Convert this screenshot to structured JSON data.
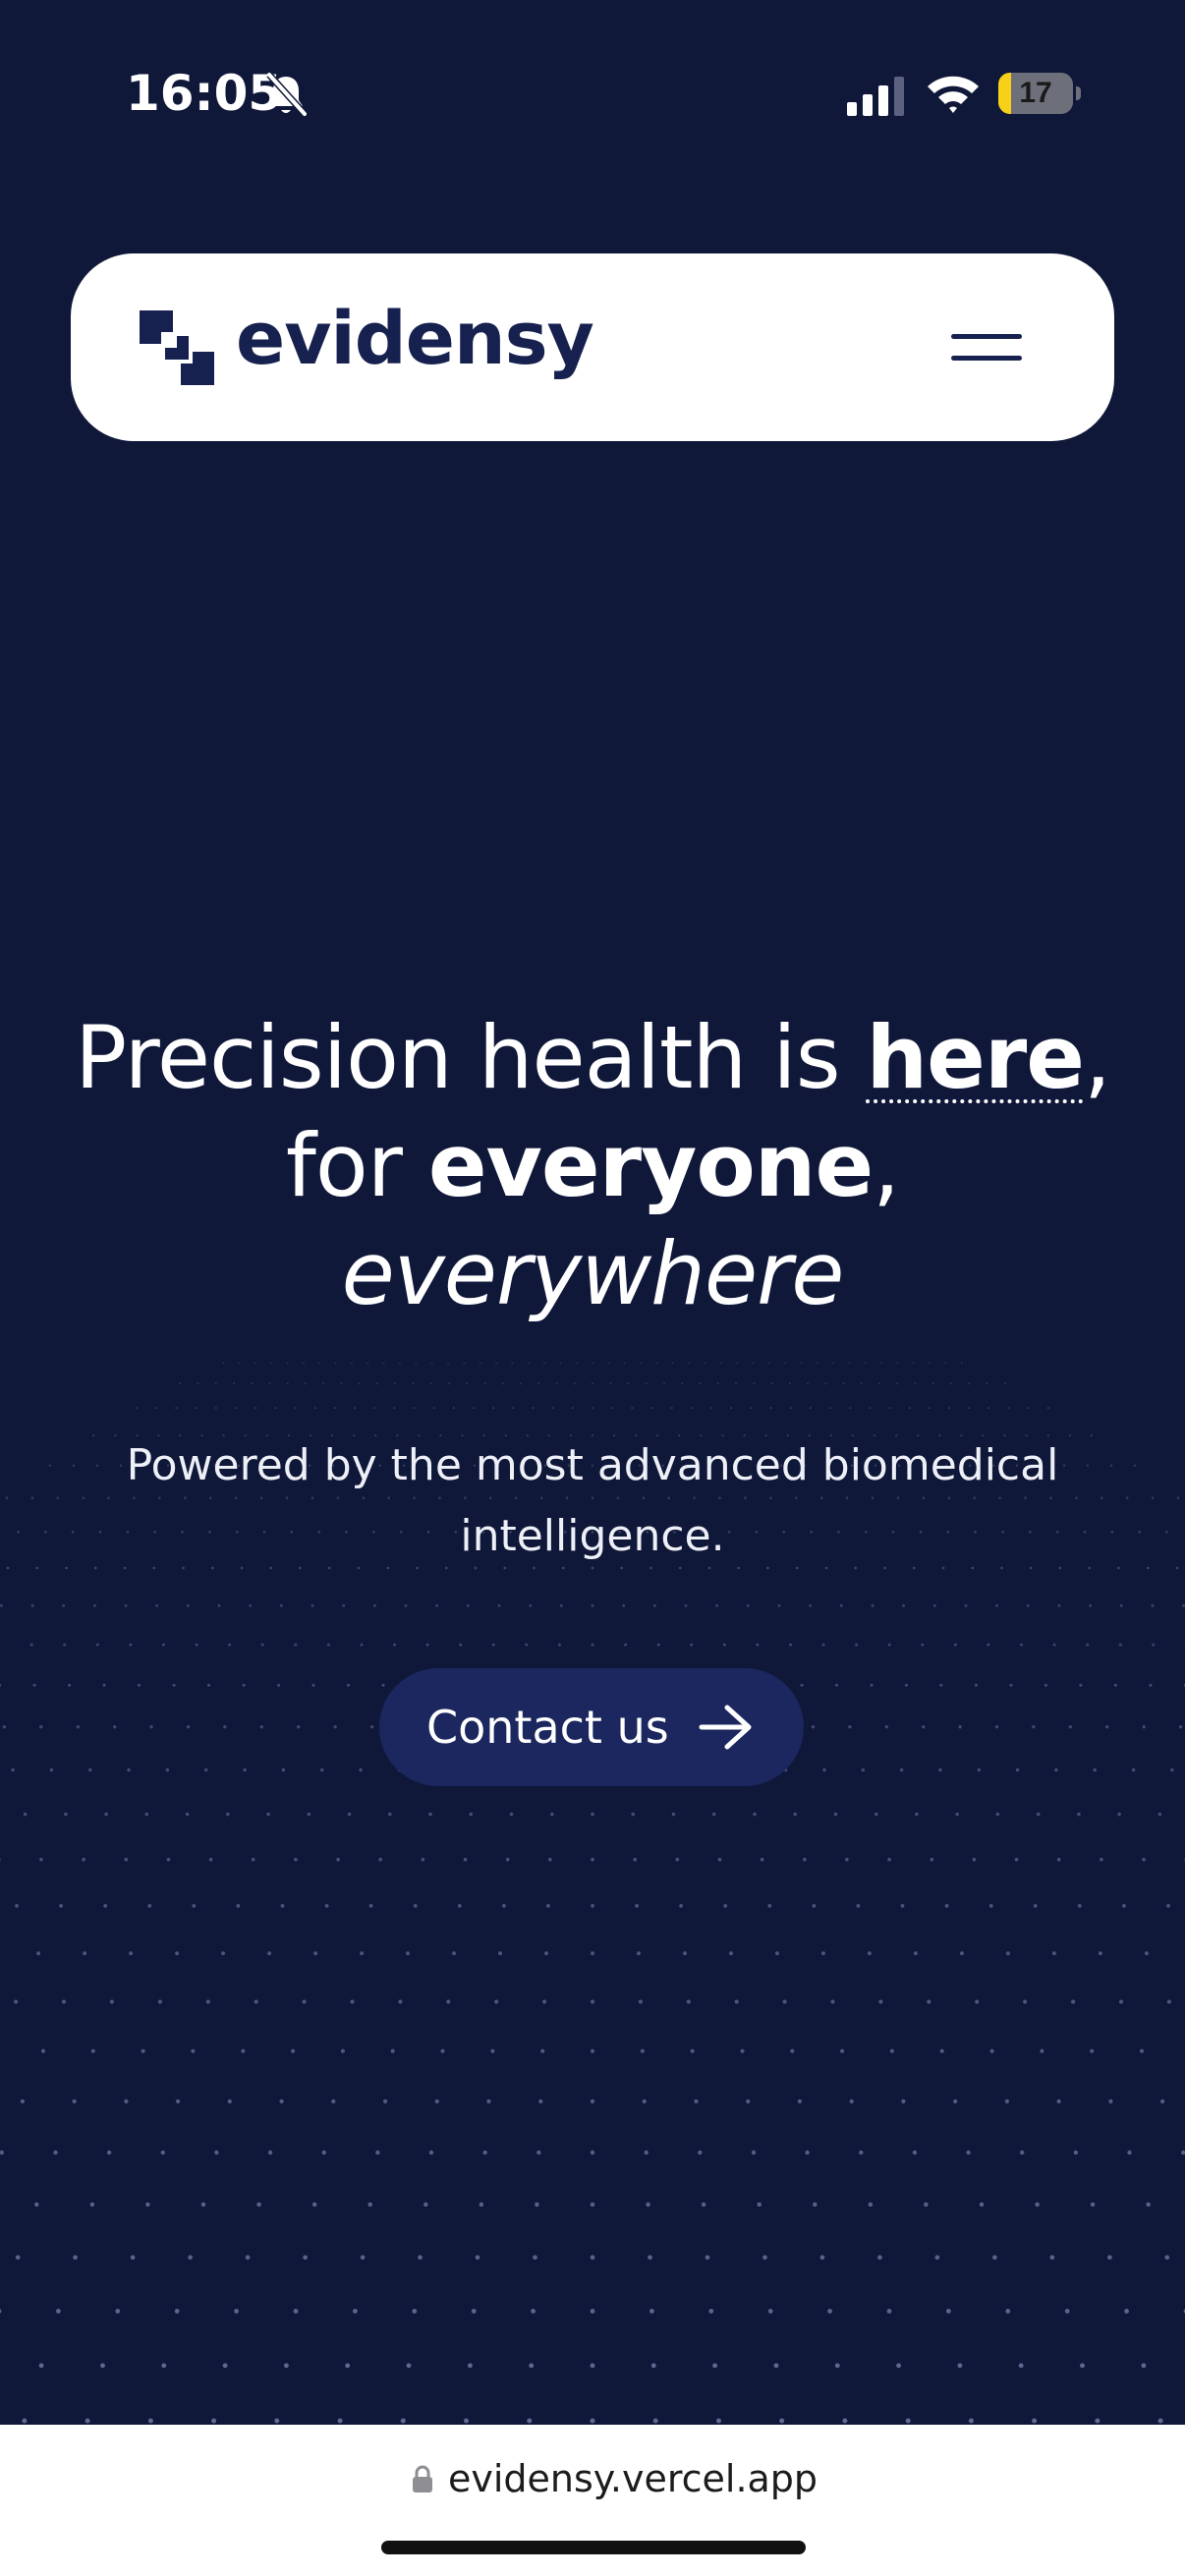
{
  "status_bar": {
    "time": "16:05",
    "battery_level": "17",
    "battery_fraction": 0.17,
    "battery_color": "#f7d117",
    "icons": [
      "bell-slash-icon",
      "cellular-signal-icon",
      "wifi-icon",
      "battery-icon"
    ]
  },
  "nav": {
    "brand": "evidensy",
    "logo_icon": "evidensy-logo-mark",
    "menu_icon": "hamburger-menu-icon"
  },
  "hero": {
    "title_prefix": "Precision health is ",
    "title_here": "here",
    "title_comma_1": ",",
    "title_for": "for ",
    "title_everyone": "everyone",
    "title_comma_2": ",",
    "title_everywhere": "everywhere",
    "subtitle": "Powered by the most advanced biomedical intelligence.",
    "cta_label": "Contact us",
    "cta_icon": "arrow-right-icon"
  },
  "browser": {
    "url": "evidensy.vercel.app",
    "lock_icon": "lock-icon"
  },
  "colors": {
    "background": "#101839",
    "brand_navy": "#17214f",
    "button_bg": "#1b275e",
    "text_light": "#ffffff"
  }
}
